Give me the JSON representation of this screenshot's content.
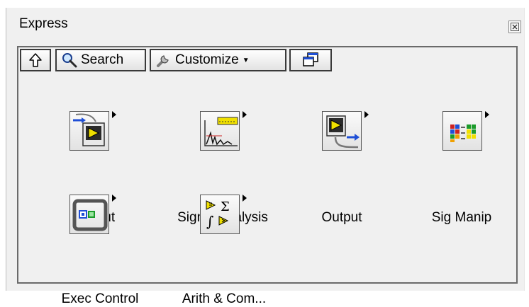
{
  "window": {
    "title": "Express",
    "close_icon": "close-icon"
  },
  "toolbar": {
    "up_icon": "up-arrow-icon",
    "search_label": "Search",
    "search_icon": "magnifier-icon",
    "customize_label": "Customize",
    "customize_icon": "wrench-icon",
    "window_icon": "restore-window-icon"
  },
  "palette_items": [
    {
      "label": "Input",
      "icon": "input-icon"
    },
    {
      "label": "Signal Analysis",
      "icon": "signal-analysis-icon"
    },
    {
      "label": "Output",
      "icon": "output-icon"
    },
    {
      "label": "Sig Manip",
      "icon": "sig-manip-icon"
    },
    {
      "label": "Exec Control",
      "icon": "exec-control-icon"
    },
    {
      "label": "Arith & Com...",
      "icon": "arith-comparison-icon"
    }
  ],
  "colors": {
    "palette_bg": "#f0f0f0",
    "frame_border": "#6a6a6a",
    "accent_blue": "#1f4fd6",
    "accent_yellow": "#f0e000"
  }
}
